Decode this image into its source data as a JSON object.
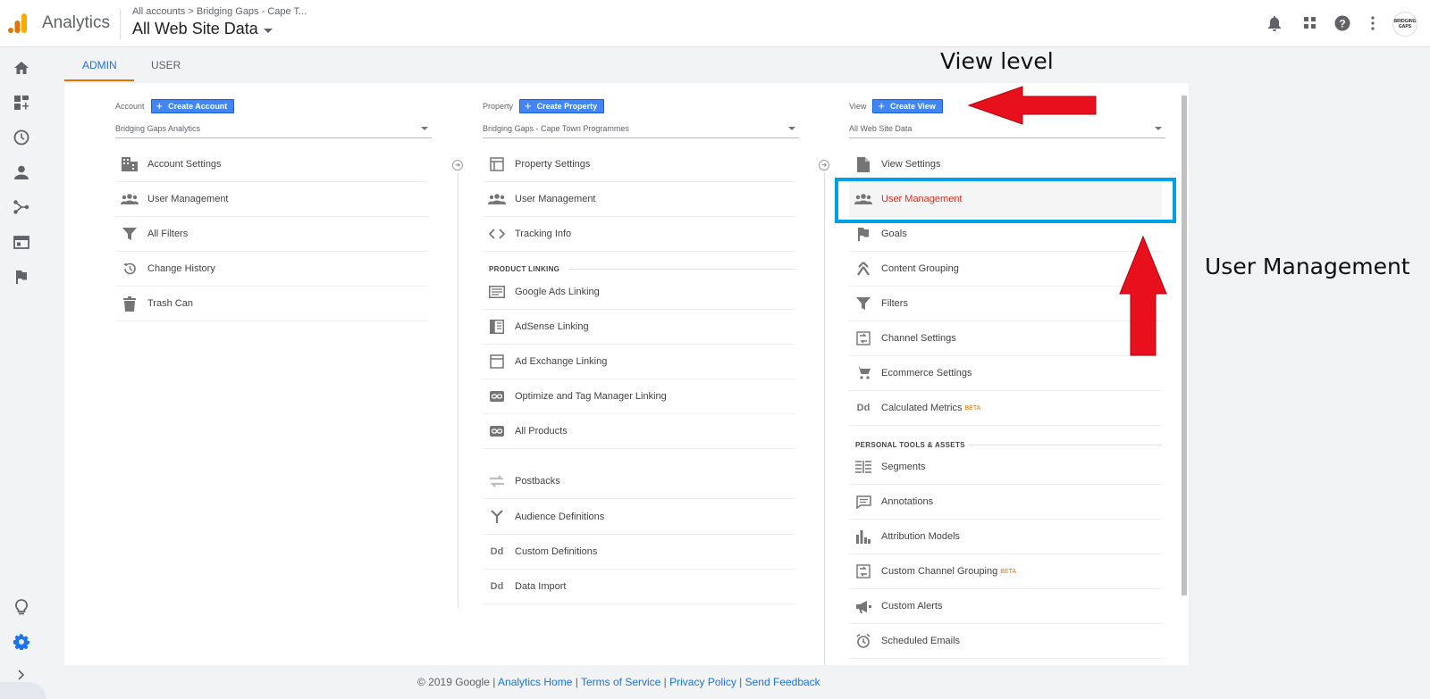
{
  "header": {
    "app_name": "Analytics",
    "breadcrumb": "All accounts > Bridging Gaps - Cape T...",
    "property_title": "All Web Site Data"
  },
  "tabs": [
    {
      "label": "ADMIN",
      "active": true
    },
    {
      "label": "USER",
      "active": false
    }
  ],
  "account": {
    "label": "Account",
    "create_label": "Create Account",
    "selected": "Bridging Gaps Analytics",
    "items": [
      {
        "icon": "building-icon",
        "label": "Account Settings"
      },
      {
        "icon": "people-icon",
        "label": "User Management"
      },
      {
        "icon": "filter-icon",
        "label": "All Filters"
      },
      {
        "icon": "history-icon",
        "label": "Change History"
      },
      {
        "icon": "trash-icon",
        "label": "Trash Can"
      }
    ]
  },
  "property": {
    "label": "Property",
    "create_label": "Create Property",
    "selected": "Bridging Gaps - Cape Town Programmes",
    "items": [
      {
        "icon": "layout-icon",
        "label": "Property Settings"
      },
      {
        "icon": "people-icon",
        "label": "User Management"
      },
      {
        "icon": "code-icon",
        "label": "Tracking Info"
      }
    ],
    "section_label": "PRODUCT LINKING",
    "linking_items": [
      {
        "icon": "ads-icon",
        "label": "Google Ads Linking"
      },
      {
        "icon": "adsense-icon",
        "label": "AdSense Linking"
      },
      {
        "icon": "adexchange-icon",
        "label": "Ad Exchange Linking"
      },
      {
        "icon": "link-icon",
        "label": "Optimize and Tag Manager Linking"
      },
      {
        "icon": "link-icon",
        "label": "All Products"
      }
    ],
    "other_items": [
      {
        "icon": "postbacks-icon",
        "label": "Postbacks"
      },
      {
        "icon": "audience-icon",
        "label": "Audience Definitions"
      },
      {
        "icon": "dd-icon",
        "label": "Custom Definitions"
      },
      {
        "icon": "dd-icon",
        "label": "Data Import"
      }
    ]
  },
  "view": {
    "label": "View",
    "create_label": "Create View",
    "selected": "All Web Site Data",
    "items": [
      {
        "icon": "document-icon",
        "label": "View Settings"
      },
      {
        "icon": "people-icon",
        "label": "User Management",
        "highlight": true
      },
      {
        "icon": "flag-icon",
        "label": "Goals"
      },
      {
        "icon": "grouping-icon",
        "label": "Content Grouping"
      },
      {
        "icon": "filter-icon",
        "label": "Filters"
      },
      {
        "icon": "channel-icon",
        "label": "Channel Settings"
      },
      {
        "icon": "cart-icon",
        "label": "Ecommerce Settings"
      },
      {
        "icon": "dd-icon",
        "label": "Calculated Metrics",
        "badge": "BETA"
      }
    ],
    "section_label": "PERSONAL TOOLS & ASSETS",
    "tools_items": [
      {
        "icon": "segments-icon",
        "label": "Segments"
      },
      {
        "icon": "annotation-icon",
        "label": "Annotations"
      },
      {
        "icon": "bars-icon",
        "label": "Attribution Models"
      },
      {
        "icon": "channel-icon",
        "label": "Custom Channel Grouping",
        "badge": "BETA"
      },
      {
        "icon": "megaphone-icon",
        "label": "Custom Alerts"
      },
      {
        "icon": "alarm-icon",
        "label": "Scheduled Emails"
      }
    ]
  },
  "annotations": {
    "view_level": "View level",
    "user_management": "User Management"
  },
  "footer": {
    "copyright": "© 2019 Google |",
    "links": [
      "Analytics Home",
      "Terms of Service",
      "Privacy Policy",
      "Send Feedback"
    ]
  },
  "avatar_text": "BRIDGING GAPS",
  "colors": {
    "accent_blue": "#4285f4",
    "tab_underline": "#e37400",
    "highlight_box": "#00a0e6",
    "arrow_red": "#e8101c",
    "active_link_red": "#d93025"
  }
}
